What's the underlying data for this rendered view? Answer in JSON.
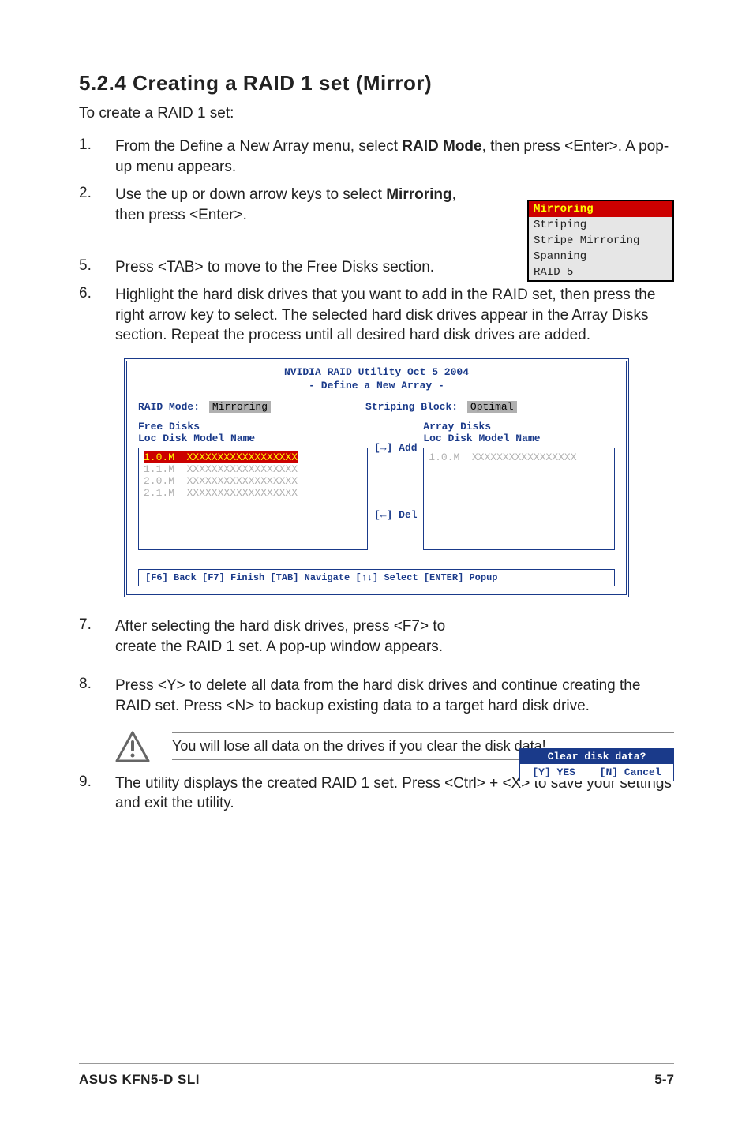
{
  "section_title": "5.2.4   Creating a RAID 1 set (Mirror)",
  "intro": "To create a RAID 1 set:",
  "steps": {
    "s1_pre": "From the Define a New Array menu, select ",
    "s1_bold": "RAID Mode",
    "s1_post": ", then press <Enter>. A pop-up menu appears.",
    "s2_pre": "Use the up or down arrow keys to select ",
    "s2_bold": "Mirroring",
    "s2_post": ", then press <Enter>.",
    "s5": "Press <TAB> to move to the Free Disks section.",
    "s6": "Highlight the hard disk drives that you want to add in the RAID set, then press the right arrow key to select. The selected hard disk drives appear in the Array Disks section. Repeat the process until all desired hard disk drives are added.",
    "s7": "After selecting the hard disk drives, press <F7> to create the RAID 1 set. A pop-up window appears.",
    "s8": "Press <Y> to delete all data from the hard disk drives and continue creating the RAID set. Press <N> to backup existing data to a target hard disk drive.",
    "s9": "The utility displays the created RAID 1 set. Press <Ctrl> + <X> to save your settings and exit the utility."
  },
  "popup": {
    "items": [
      "Mirroring",
      "Striping",
      "Stripe Mirroring",
      "Spanning",
      "RAID 5"
    ]
  },
  "nvidia": {
    "title": "NVIDIA RAID Utility  Oct 5 2004",
    "subtitle": "- Define a New Array -",
    "raid_mode_label": "RAID Mode:",
    "raid_mode_value": "Mirroring",
    "striping_label": "Striping Block:",
    "striping_value": "Optimal",
    "free_disks_label": "Free Disks",
    "array_disks_label": "Array Disks",
    "col_header": "Loc    Disk Model Name",
    "free_rows": [
      {
        "loc": "1.0.M",
        "name": "XXXXXXXXXXXXXXXXXX",
        "sel": true
      },
      {
        "loc": "1.1.M",
        "name": "XXXXXXXXXXXXXXXXXX",
        "sel": false
      },
      {
        "loc": "2.0.M",
        "name": "XXXXXXXXXXXXXXXXXX",
        "sel": false
      },
      {
        "loc": "2.1.M",
        "name": "XXXXXXXXXXXXXXXXXX",
        "sel": false
      }
    ],
    "array_rows": [
      {
        "loc": "1.0.M",
        "name": "XXXXXXXXXXXXXXXXX"
      }
    ],
    "op_add": "[→] Add",
    "op_del": "[←] Del",
    "footer": "[F6] Back  [F7] Finish  [TAB] Navigate  [↑↓] Select  [ENTER] Popup"
  },
  "clear_popup": {
    "title": "Clear disk data?",
    "yes": "[Y] YES",
    "no": "[N] Cancel"
  },
  "warning": "You will lose all data on the drives if you clear the disk data!",
  "footer": {
    "left": "ASUS KFN5-D SLI",
    "right": "5-7"
  }
}
